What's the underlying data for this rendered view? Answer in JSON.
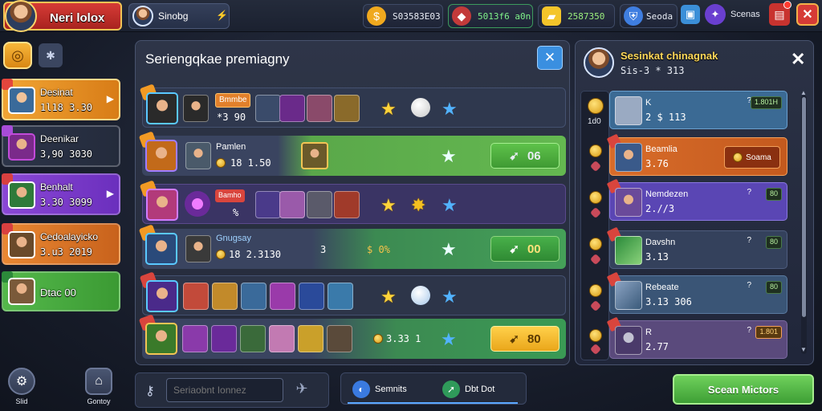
{
  "topbar": {
    "player_name": "Neri lolox",
    "friend_name": "Sinobg",
    "friend_icon": "rocket-icon",
    "resources": {
      "coins": "S03583E03",
      "gems": "5013f6 a0n",
      "gold": "2587350",
      "shield": "Seoda"
    },
    "status_label": "Scenas",
    "colors": {
      "accent_red": "#d63b36",
      "accent_gold": "#f0c454"
    }
  },
  "sidebar": {
    "cards": [
      {
        "name": "Desinat",
        "value": "1l18 3.30"
      },
      {
        "name": "Deenikar",
        "value": "3,90 3030"
      },
      {
        "name": "Benhalt",
        "value": "3.30 3099"
      },
      {
        "name": "Cedoalayicko",
        "value": "3.u3 2019"
      },
      {
        "name": "Dtac 00",
        "value": ""
      }
    ],
    "bottom_nav": [
      {
        "label": "Slid",
        "icon": "settings-icon"
      },
      {
        "label": "Gontoy",
        "icon": "shop-icon"
      }
    ]
  },
  "main": {
    "title": "Seriengqkae premiagny",
    "rows": [
      {
        "pill": "Bmmbe",
        "value": "*3 90"
      },
      {
        "name": "Pamlen",
        "value": "18 1.50",
        "action": "06"
      },
      {
        "pill": "Bamho",
        "value": "%"
      },
      {
        "name": "Gnugsay",
        "value": "18 2.3130",
        "mid": "3",
        "mid2": "$ 0%",
        "action": "00"
      },
      {
        "value": ""
      },
      {
        "value": "3.33 1",
        "action": "80"
      }
    ]
  },
  "bottom": {
    "search_placeholder": "Seriaobnt Ionnez",
    "tabs": [
      {
        "label": "Semnits",
        "icon": "planet-icon"
      },
      {
        "label": "Dbt Dot",
        "icon": "arrow-icon"
      }
    ],
    "primary_button": "Scean Mictors"
  },
  "right_panel": {
    "title": "Sesinkat chinagnak",
    "subtitle": "Sis-3 * 313",
    "col_value": "1d0",
    "rows": [
      {
        "name": "K",
        "value": "2 $ 113",
        "tag": "1.801H",
        "q": "?"
      },
      {
        "name": "Beamlia",
        "value": "3.76",
        "pill": "Soama"
      },
      {
        "name": "Nemdezen",
        "value": "2.//3",
        "tag": "80",
        "q": "?"
      },
      {
        "name": "Davshn",
        "value": "3.13",
        "tag": "80",
        "q": "?"
      },
      {
        "name": "Rebeate",
        "value": "3.13 306",
        "tag": "80",
        "q": "?"
      },
      {
        "name": "R",
        "value": "2.77",
        "tag": "1.801",
        "q": "?"
      }
    ]
  }
}
